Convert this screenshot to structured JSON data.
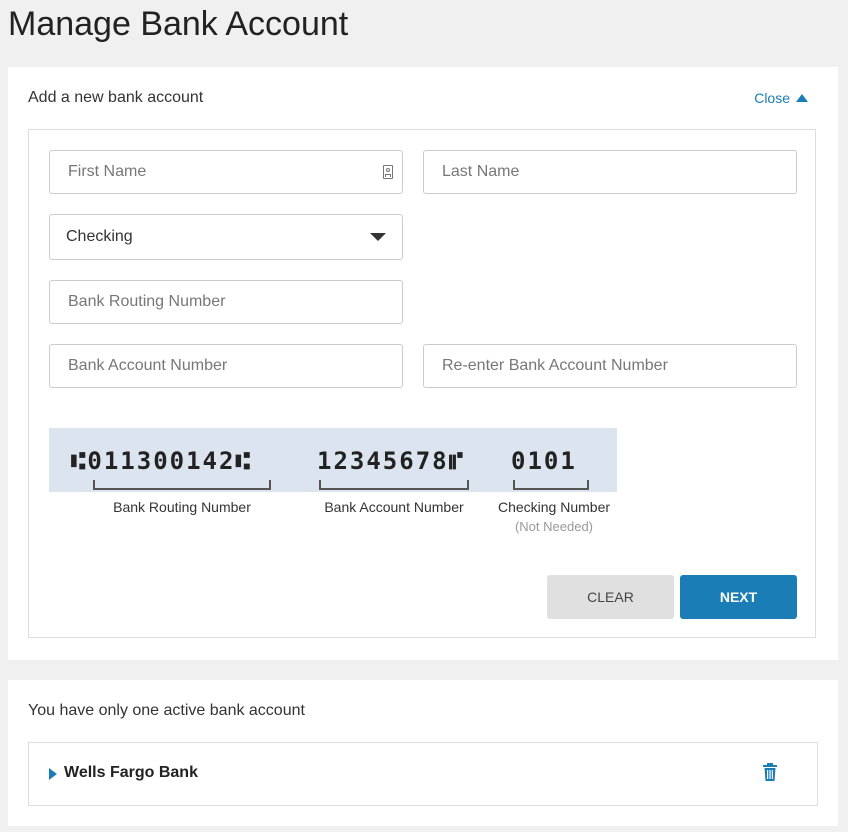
{
  "page": {
    "title": "Manage Bank Account"
  },
  "add_account": {
    "header": "Add a new bank account",
    "close_label": "Close",
    "first_name_placeholder": "First Name",
    "last_name_placeholder": "Last Name",
    "account_type": {
      "selected": "Checking"
    },
    "routing_placeholder": "Bank Routing Number",
    "account_number_placeholder": "Bank Account Number",
    "reenter_account_placeholder": "Re-enter Bank Account Number",
    "check_diagram": {
      "routing_micr": "⑆011300142⑆",
      "account_micr": "12345678⑈",
      "check_micr": "0101",
      "routing_label": "Bank Routing Number",
      "account_label": "Bank Account Number",
      "check_label": "Checking Number",
      "check_sublabel": "(Not Needed)"
    },
    "clear_label": "CLEAR",
    "next_label": "NEXT"
  },
  "active_accounts": {
    "message": "You have only one active bank account",
    "accounts": [
      {
        "name": "Wells Fargo Bank"
      }
    ]
  },
  "colors": {
    "accent": "#1a7db5",
    "check_band": "#dbe4ef"
  },
  "icons": [
    "contact-card-icon",
    "chevron-down-icon",
    "caret-up-icon",
    "caret-right-icon",
    "trash-icon"
  ]
}
